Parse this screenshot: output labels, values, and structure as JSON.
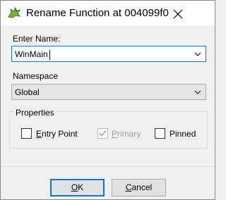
{
  "window": {
    "title": "Rename Function at 004099f0",
    "icons": {
      "app": "dragon-app-icon",
      "close": "close-icon"
    }
  },
  "name_field": {
    "label": "Enter Name:",
    "value": "WinMain"
  },
  "namespace_field": {
    "label": "Namespace",
    "value": "Global"
  },
  "properties": {
    "label": "Properties",
    "entry_point": {
      "label": "Entry Point",
      "checked": false,
      "enabled": true
    },
    "primary": {
      "label": "Primary",
      "checked": true,
      "enabled": false
    },
    "pinned": {
      "label": "Pinned",
      "checked": false,
      "enabled": true
    }
  },
  "buttons": {
    "ok": {
      "label_underlined": "O",
      "label_rest": "K"
    },
    "cancel": {
      "label_underlined": "C",
      "label_rest": "ancel"
    }
  },
  "colors": {
    "accent": "#0078d7",
    "dialog_bg": "#f0f0f0",
    "titlebar_bg": "#ffffff",
    "disabled_text": "#a0a0a0"
  }
}
